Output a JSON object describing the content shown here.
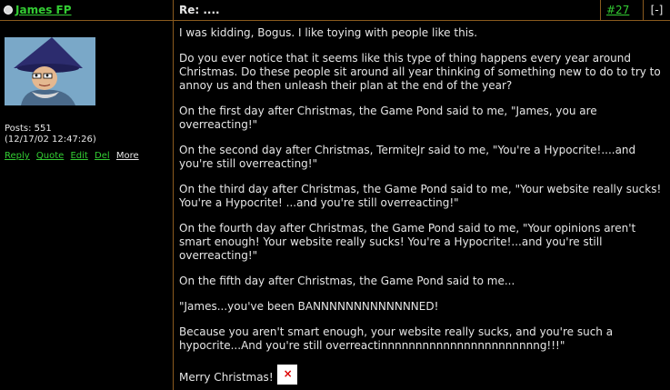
{
  "header": {
    "author": "James FP",
    "subject": "Re: ....",
    "post_number": "#27",
    "collapse_label": "[-]"
  },
  "sidebar": {
    "posts": "Posts: 551",
    "timestamp": "(12/17/02 12:47:26)",
    "actions": {
      "reply": "Reply",
      "quote": "Quote",
      "edit": "Edit",
      "del": "Del",
      "more": "More"
    }
  },
  "body": {
    "paragraphs": [
      "I was kidding, Bogus. I like toying with people like this.",
      "Do you ever notice that it seems like this type of thing happens every year around Christmas. Do these people sit around all year thinking of something new to do to try to annoy us and then unleash their plan at the end of the year?",
      "On the first day after Christmas, the Game Pond said to me, \"James, you are overreacting!\"",
      "On the second day after Christmas, TermiteJr said to me, \"You're a Hypocrite!....and you're still overreacting!\"",
      "On the third day after Christmas, the Game Pond said to me, \"Your website really sucks! You're a Hypocrite! ...and you're still overreacting!\"",
      "On the fourth day after Christmas, the Game Pond said to me, \"Your opinions aren't smart enough! Your website really sucks! You're a Hypocrite!...and you're still overreacting!\"",
      "On the fifth day after Christmas, the Game Pond said to me...",
      "\"James...you've been BANNNNNNNNNNNNNED!",
      "Because you aren't smart enough, your website really sucks, and you're such a hypocrite...And you're still overreactinnnnnnnnnnnnnnnnnnnnnnng!!!\""
    ],
    "closing": "Merry Christmas!"
  }
}
